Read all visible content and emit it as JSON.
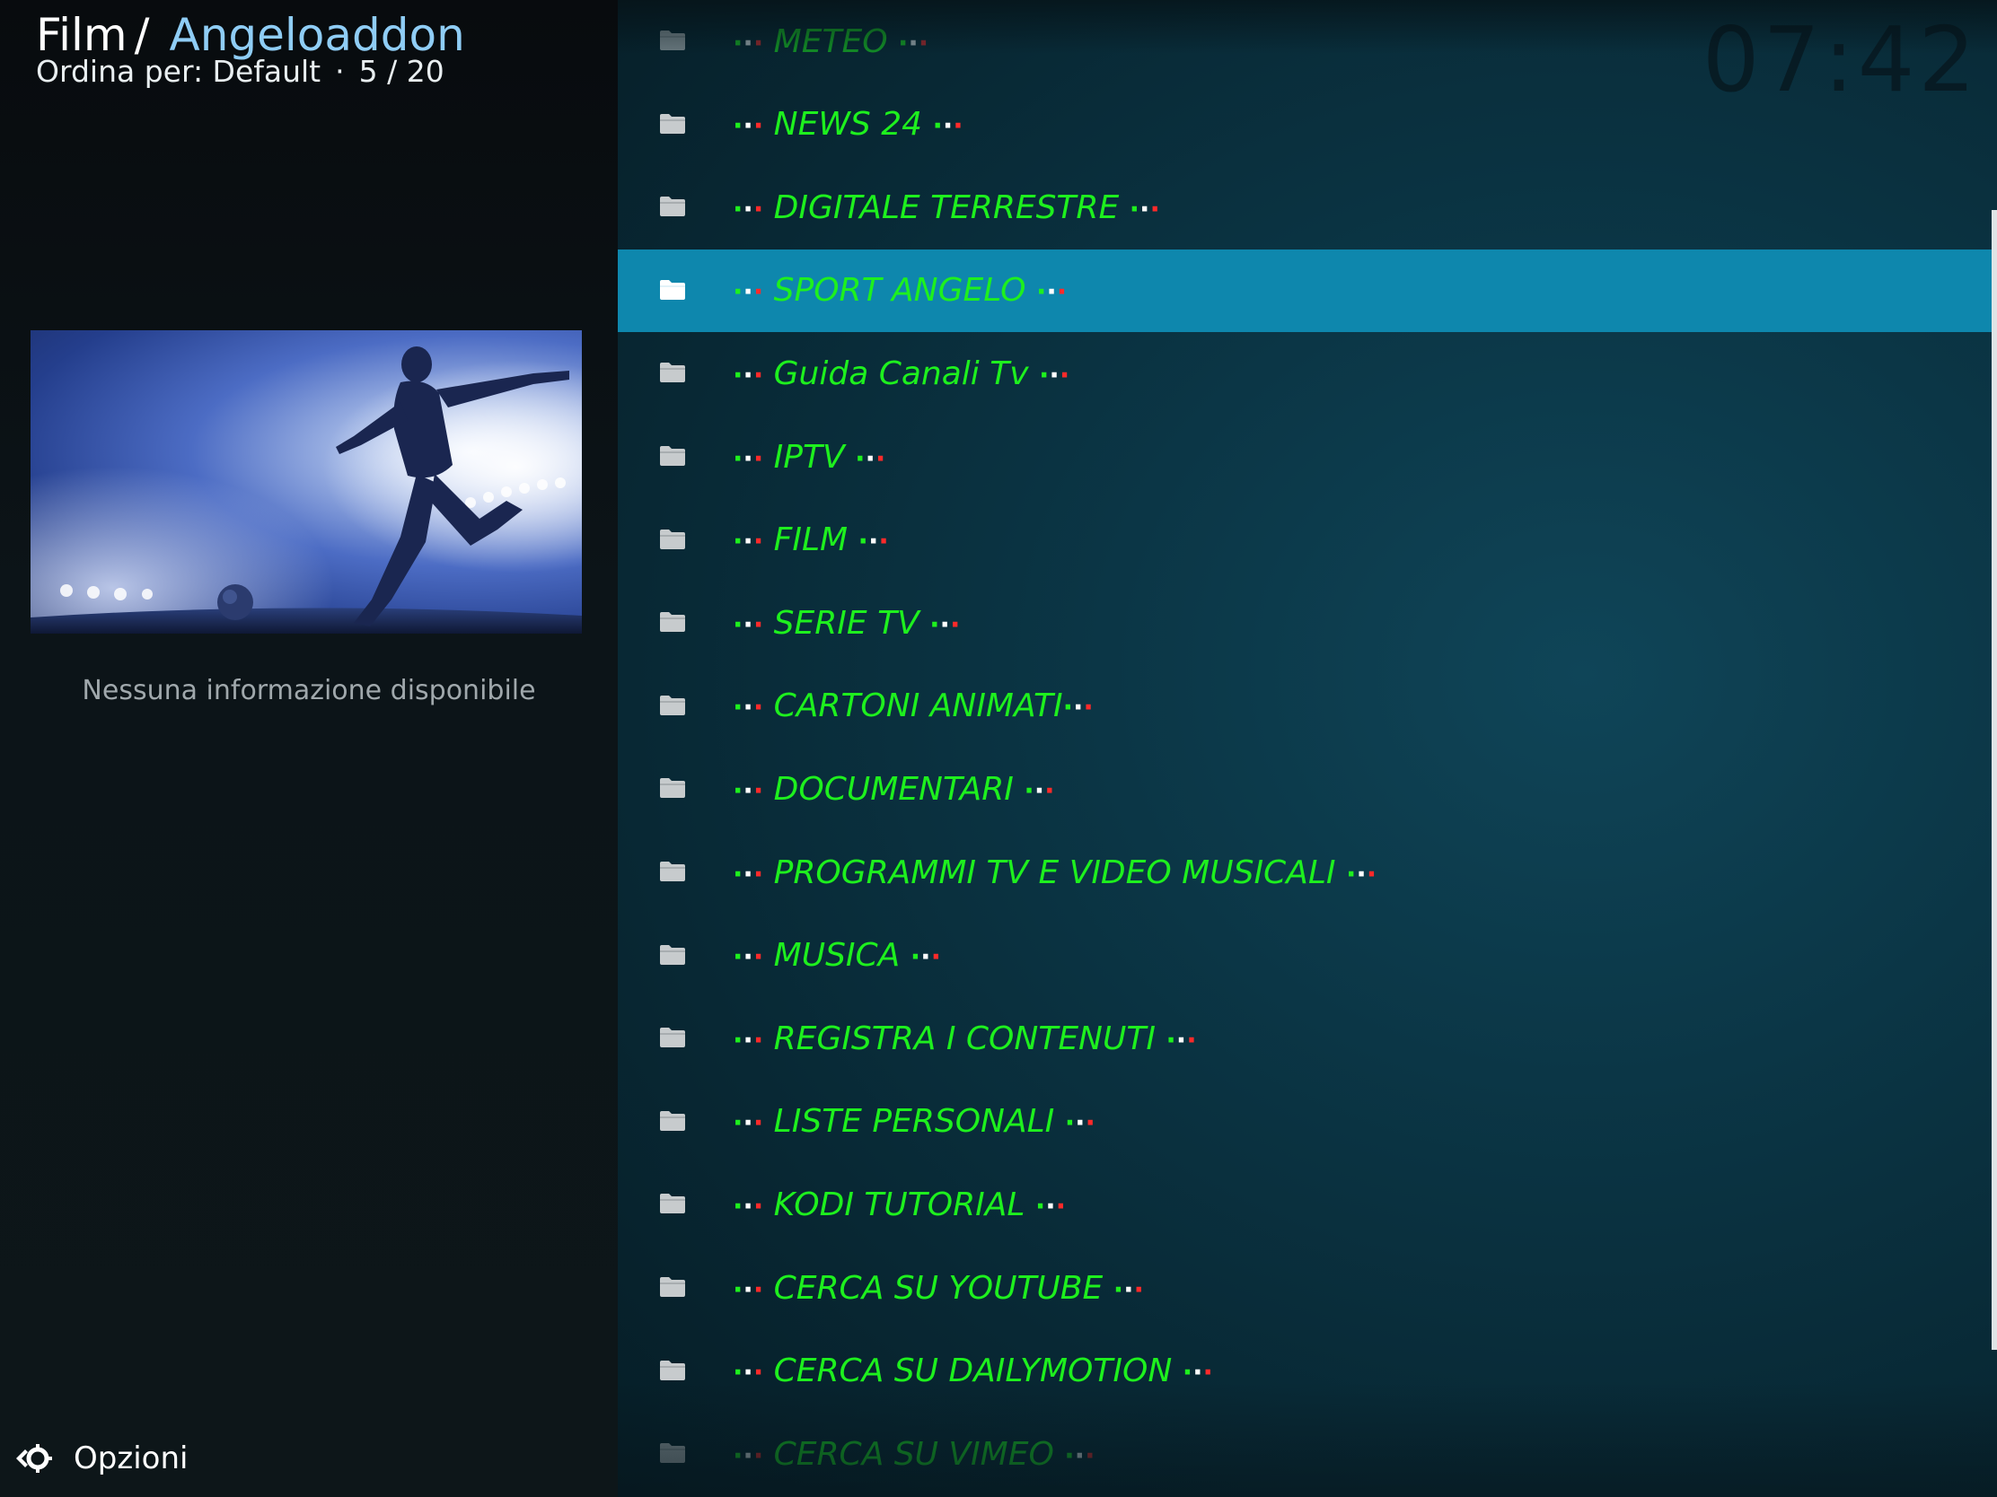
{
  "header": {
    "root": "Film",
    "separator": "/",
    "addon": "Angeloaddon",
    "sort_label": "Ordina per: Default",
    "position_dot": "·",
    "position": "5 / 20"
  },
  "clock": "07:42",
  "info": {
    "no_info": "Nessuna informazione disponibile"
  },
  "footer": {
    "options_label": "Opzioni"
  },
  "list": {
    "selected_index": 3,
    "items": [
      {
        "label": "METEO",
        "suffix_space": true
      },
      {
        "label": "NEWS 24",
        "suffix_space": true
      },
      {
        "label": "DIGITALE TERRESTRE",
        "suffix_space": true
      },
      {
        "label": "SPORT ANGELO",
        "suffix_space": true
      },
      {
        "label": "Guida Canali Tv",
        "suffix_space": true
      },
      {
        "label": "IPTV",
        "suffix_space": true
      },
      {
        "label": "FILM",
        "suffix_space": true
      },
      {
        "label": "SERIE TV",
        "suffix_space": true
      },
      {
        "label": "CARTONI ANIMATI",
        "suffix_space": false
      },
      {
        "label": "DOCUMENTARI",
        "suffix_space": true
      },
      {
        "label": "PROGRAMMI TV E VIDEO MUSICALI",
        "suffix_space": true
      },
      {
        "label": "MUSICA",
        "suffix_space": true
      },
      {
        "label": "REGISTRA I CONTENUTI",
        "suffix_space": true
      },
      {
        "label": "LISTE PERSONALI",
        "suffix_space": true
      },
      {
        "label": "KODI TUTORIAL",
        "suffix_space": true
      },
      {
        "label": "CERCA SU YOUTUBE",
        "suffix_space": true
      },
      {
        "label": "CERCA SU DAILYMOTION",
        "suffix_space": true
      },
      {
        "label": "CERCA SU VIMEO",
        "suffix_space": true
      }
    ]
  },
  "icons": {
    "folder": "folder-icon",
    "options": "options-icon"
  },
  "colors": {
    "item_text": "#1ef01e",
    "selected_bg": "#0e87ad",
    "addon_title": "#8fcdf5",
    "dot_green": "#1ef01e",
    "dot_white": "#ffffff",
    "dot_red": "#ff2a2a"
  }
}
